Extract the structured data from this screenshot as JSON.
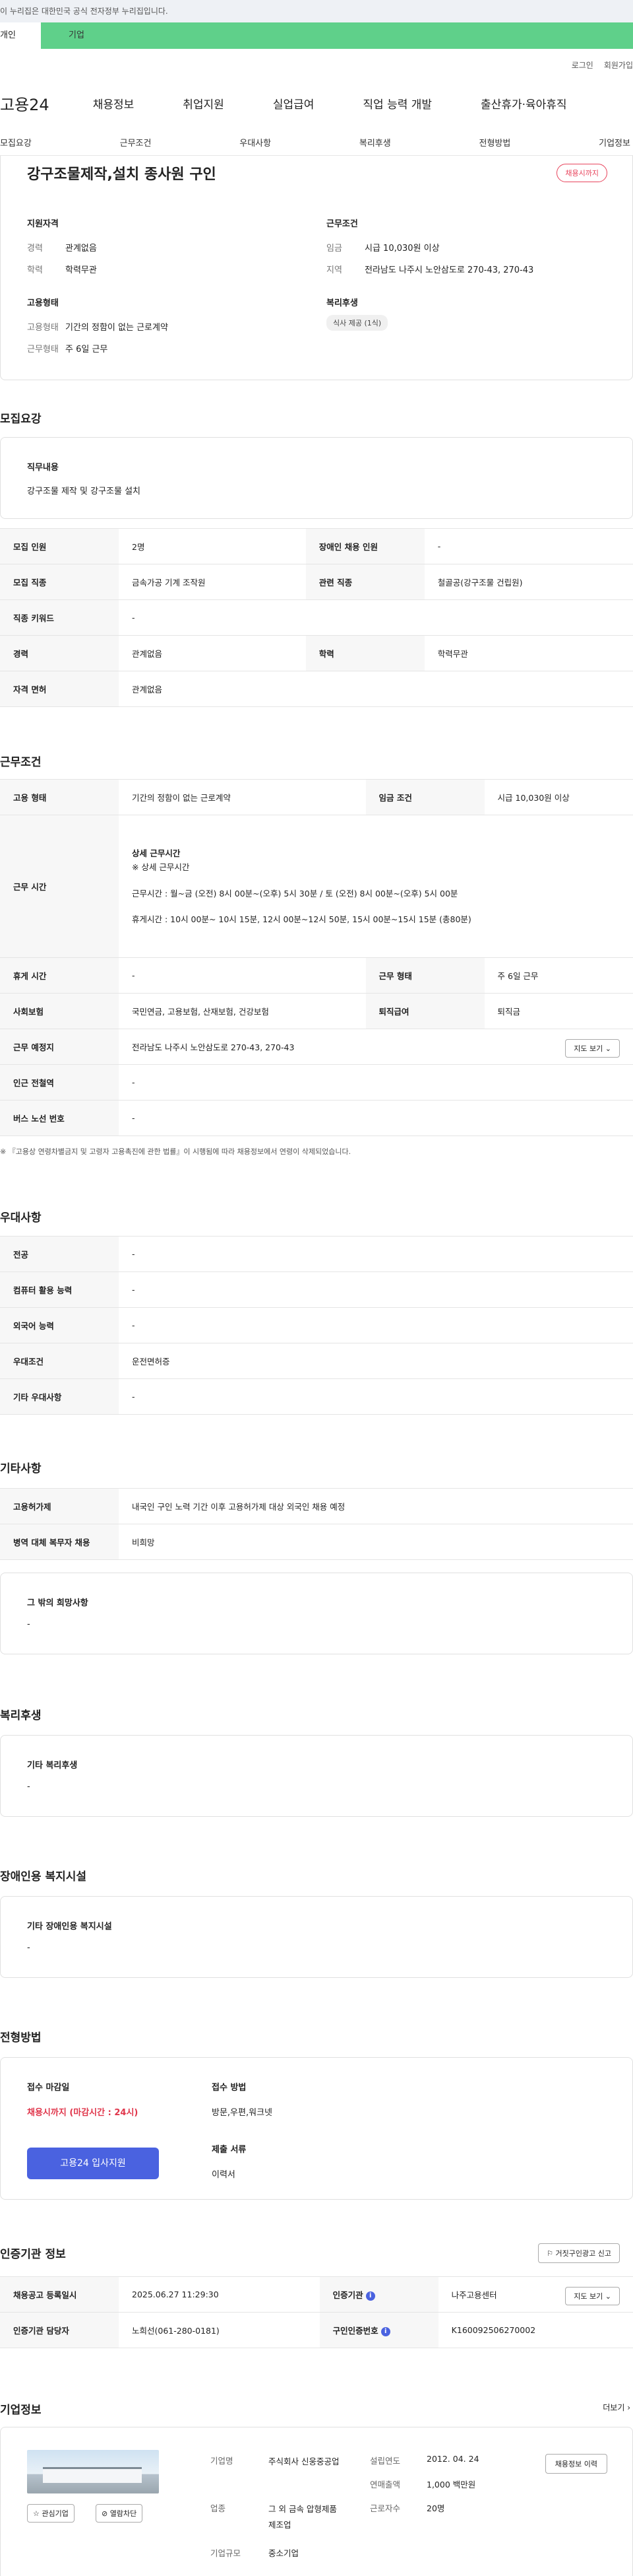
{
  "gov_banner": "이 누리집은 대한민국 공식 전자정부 누리집입니다.",
  "gov_tabs": [
    "개인",
    "기업"
  ],
  "util": [
    "로그인",
    "회원가입"
  ],
  "gnb": {
    "logo": "고용24",
    "items": [
      "채용정보",
      "취업지원",
      "실업급여",
      "직업 능력 개발",
      "출산휴가·육아휴직"
    ]
  },
  "anchors": [
    "모집요강",
    "근무조건",
    "우대사항",
    "복리후생",
    "전형방법",
    "기업정보"
  ],
  "summary": {
    "title": "강구조물제작,설치 종사원 구인",
    "badge": "채용시까지",
    "support_title": "지원자격",
    "support": [
      {
        "k": "경력",
        "v": "관계없음"
      },
      {
        "k": "학력",
        "v": "학력무관"
      }
    ],
    "emp_title": "고용형태",
    "emp": [
      {
        "k": "고용형태",
        "v": "기간의 정함이 없는 근로계약"
      },
      {
        "k": "근무형태",
        "v": "주 6일 근무"
      }
    ],
    "cond_title": "근무조건",
    "cond": [
      {
        "k": "임금",
        "v": "시급 10,030원 이상"
      },
      {
        "k": "지역",
        "v": "전라남도 나주시 노안삼도로 270-43, 270-43"
      }
    ],
    "welfare_title": "복리후생",
    "welfare_chip": "식사 제공 (1식)"
  },
  "recruit": {
    "title": "모집요강",
    "job_title": "직무내용",
    "job_text": "강구조물 제작 및  강구조물 설치",
    "rows": [
      [
        "모집 인원",
        "2명",
        "장애인 채용 인원",
        "-"
      ],
      [
        "모집 직종",
        "금속가공 기계 조작원",
        "관련 직종",
        "철골공(강구조물 건립원)"
      ],
      [
        "직종 키워드",
        "-"
      ],
      [
        "경력",
        "관계없음",
        "학력",
        "학력무관"
      ],
      [
        "자격 면허",
        "관계없음"
      ]
    ]
  },
  "work": {
    "title": "근무조건",
    "emp_type": [
      "고용 형태",
      "기간의 정함이 없는 근로계약",
      "임금 조건",
      "시급 10,030원 이상"
    ],
    "time_label": "근무 시간",
    "time_lines": [
      "상세 근무시간",
      "※ 상세 근무시간",
      "근무시간 : 월~금 (오전) 8시 00분~(오후) 5시 30분 / 토 (오전) 8시 00분~(오후) 5시 00분",
      "휴게시간 : 10시 00분~ 10시 15분, 12시 00분~12시 50분, 15시 00분~15시 15분 (총80분)"
    ],
    "rest": [
      "휴게 시간",
      "-",
      "근무 형태",
      "주 6일 근무"
    ],
    "insure": [
      "사회보험",
      "국민연금, 고용보험, 산재보험, 건강보험",
      "퇴직급여",
      "퇴직금"
    ],
    "place": [
      "근무 예정지",
      "전라남도 나주시 노안삼도로 270-43, 270-43"
    ],
    "map_btn": "지도 보기",
    "station": [
      "인근 전철역",
      "-"
    ],
    "bus": [
      "버스 노선 번호",
      "-"
    ],
    "note": "※ 『고용상 연령차별금지 및 고령자 고용촉진에 관한 법률』이 시행됨에 따라 채용정보에서 연령이 삭제되었습니다."
  },
  "pref": {
    "title": "우대사항",
    "rows": [
      [
        "전공",
        "-"
      ],
      [
        "컴퓨터 활용 능력",
        "-"
      ],
      [
        "외국어 능력",
        "-"
      ],
      [
        "우대조건",
        "운전면허증"
      ],
      [
        "기타 우대사항",
        "-"
      ]
    ]
  },
  "etc": {
    "title": "기타사항",
    "rows": [
      [
        "고용허가제",
        "내국인 구인 노력 기간 이후 고용허가제 대상 외국인 채용 예정"
      ],
      [
        "병역 대체 복무자 채용",
        "비희망"
      ]
    ],
    "wish_title": "그 밖의 희망사항",
    "wish_text": "-"
  },
  "welfare": {
    "title": "복리후생",
    "box_title": "기타 복리후생",
    "box_text": "-"
  },
  "disabled": {
    "title": "장애인용 복지시설",
    "box_title": "기타 장애인용 복지시설",
    "box_text": "-"
  },
  "process": {
    "title": "전형방법",
    "deadline_title": "접수 마감일",
    "deadline": "채용시까지 (마감시간 : 24시)",
    "apply_btn": "고용24 입사지원",
    "method_title": "접수 방법",
    "method": "방문,우편,워크넷",
    "docs_title": "제출 서류",
    "docs": "이력서"
  },
  "agency": {
    "title": "인증기관 정보",
    "report_btn": "거짓구인광고 신고",
    "rows": [
      [
        "채용공고 등록일시",
        "2025.06.27 11:29:30",
        "인증기관",
        "나주고용센터"
      ],
      [
        "인증기관 담당자",
        "노희선(061-280-0181)",
        "구인인증번호",
        "K160092506270002"
      ]
    ],
    "map_btn": "지도 보기"
  },
  "company": {
    "title": "기업정보",
    "more": "더보기",
    "name_k": "기업명",
    "name": "주식회사 신웅중공업",
    "biz_k": "업종",
    "biz": "그 외 금속 압형제품 제조업",
    "size_k": "기업규모",
    "size": "중소기업",
    "est_k": "설립연도",
    "est": "2012. 04. 24",
    "sales_k": "연매출액",
    "sales": "1,000 백만원",
    "emp_k": "근로자수",
    "emp": "20명",
    "fav": "관심기업",
    "block": "열람차단",
    "info_btn": "채용정보 이력"
  }
}
